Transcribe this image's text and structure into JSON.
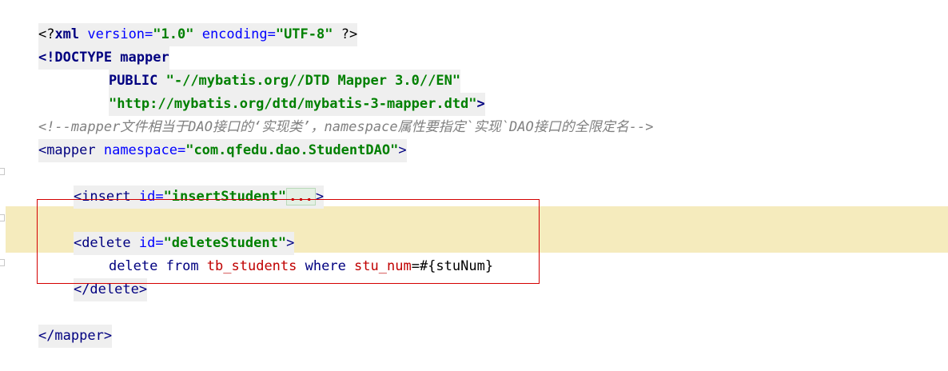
{
  "editor": {
    "line1": {
      "open": "<?",
      "name": "xml",
      "attr1": " version=",
      "val1": "\"1.0\"",
      "attr2": " encoding=",
      "val2": "\"UTF-8\"",
      "close": " ?>"
    },
    "line2": {
      "text": "<!DOCTYPE mapper"
    },
    "line3": {
      "kw": "PUBLIC ",
      "val": "\"-//mybatis.org//DTD Mapper 3.0//EN\""
    },
    "line4": {
      "val": "\"http://mybatis.org/dtd/mybatis-3-mapper.dtd\"",
      "close": ">"
    },
    "line5": {
      "comment": "<!--mapper文件相当于DAO接口的‘实现类’，namespace属性要指定`实现`DAO接口的全限定名-->"
    },
    "line6": {
      "open": "<mapper",
      "attr": " namespace=",
      "val": "\"com.qfedu.dao.StudentDAO\"",
      "close": ">"
    },
    "line8": {
      "open": "<insert",
      "attr": " id=",
      "val": "\"insertStudent\"",
      "collapsed": "...",
      "close": ">"
    },
    "line10": {
      "open": "<delete",
      "attr": " id=",
      "val": "\"deleteStudent\"",
      "close": ">"
    },
    "line11": {
      "kw1": "delete",
      "kw2": " from ",
      "table": "tb_students",
      "kw3": " where ",
      "col": "stu_num",
      "rest": "=#{stuNum}"
    },
    "line12": {
      "close": "</delete>"
    },
    "line14": {
      "close": "</mapper>"
    }
  },
  "colors": {
    "highlight": "#f5ebbd",
    "selection_border": "#d40000",
    "tag": "#000080",
    "string": "#008000",
    "comment": "#808080",
    "sql_identifier": "#c00000"
  },
  "icons": [
    "fold-marker-icon"
  ]
}
